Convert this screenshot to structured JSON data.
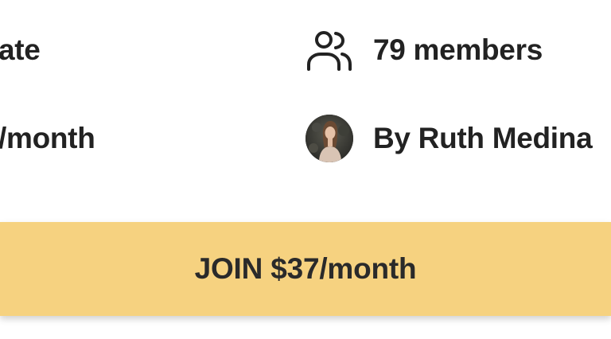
{
  "details": {
    "privacy_text": "ate",
    "price_text": "/month",
    "members": {
      "icon": "members-icon",
      "text": "79 members"
    },
    "owner": {
      "icon": "avatar",
      "text": "By Ruth Medina"
    }
  },
  "join_button": {
    "label": "JOIN $37/month",
    "color": "#f6d280"
  }
}
